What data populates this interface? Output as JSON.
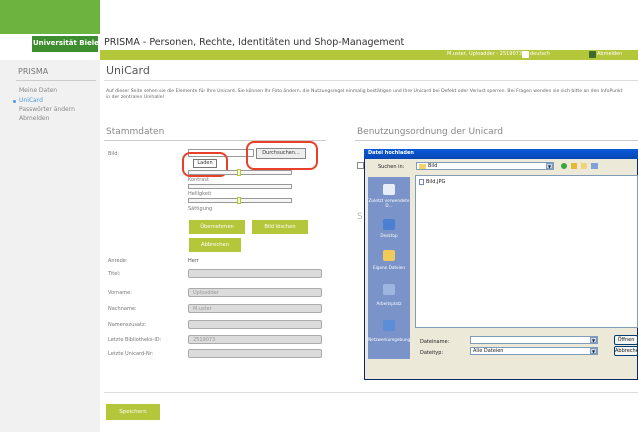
{
  "header": {
    "brand": "Universität Bielefeld",
    "app_title": "PRISMA - Personen, Rechte, Identitäten und Shop-Management",
    "user": "M.uster, Uploadder - 2519073",
    "language": "deutsch",
    "logout": "Abmelden"
  },
  "sidebar": {
    "title": "PRISMA",
    "items": [
      {
        "label": "Meine Daten"
      },
      {
        "label": "UniCard"
      },
      {
        "label": "Passwörter ändern"
      },
      {
        "label": "Abmelden"
      }
    ]
  },
  "main": {
    "title": "UniCard",
    "intro": "Auf dieser Seite sehen sie die Elemente für Ihre Unicard. Sie können Ihr Foto ändern, die Nutzungsregel einmalig bestätigen und Ihre Unicard bei Defekt oder Verlust sperren. Bei Fragen wenden sie sich bitte an den InfoPunkt in der zentralen Unihalle!",
    "stammdaten": {
      "title": "Stammdaten",
      "bild_label": "Bild:",
      "browse_button": "Durchsuchen...",
      "upload_button": "Laden",
      "kontrast_label": "Kontrast",
      "helligkeit_label": "Helligkeit",
      "saettigung_label": "Sättigung",
      "uebernehmen_button": "Übernehmen",
      "bild_drucken_button": "Bild löschen",
      "abbrechen_button": "Abbrechen",
      "anrede_label": "Anrede:",
      "anrede_value": "Herr",
      "fields": [
        {
          "label": "Titel:",
          "value": ""
        },
        {
          "label": "Vorname:",
          "value": "Uploadder"
        },
        {
          "label": "Nachname:",
          "value": "M.uster"
        },
        {
          "label": "Namenszusatz:",
          "value": ""
        },
        {
          "label": "Letzte Bibliotheks-ID:",
          "value": "2519073"
        },
        {
          "label": "Letzte Unicard-Nr:",
          "value": ""
        }
      ]
    },
    "benutzung": {
      "title": "Benutzungsordnung der Unicard",
      "partial_s": "S"
    },
    "save_button": "Speichern"
  },
  "dialog": {
    "title": "Datei hochladen",
    "suchen_in_label": "Suchen in:",
    "folder": "Bild",
    "file": "Bild.JPG",
    "places": [
      {
        "label": "Zuletzt verwendete D..."
      },
      {
        "label": "Desktop"
      },
      {
        "label": "Eigene Dateien"
      },
      {
        "label": "Arbeitsplatz"
      },
      {
        "label": "Netzwerkumgebung"
      }
    ],
    "dateiname_label": "Dateiname:",
    "dateiname_value": "",
    "dateityp_label": "Dateityp:",
    "dateityp_value": "Alle Dateien",
    "open_button": "Öffnen",
    "cancel_button": "Abbrechen"
  },
  "colors": {
    "brand_green": "#6db33f",
    "accent_lime": "#b4c63a",
    "annotation_red": "#e8402a",
    "xp_blue": "#0a5ad8"
  }
}
